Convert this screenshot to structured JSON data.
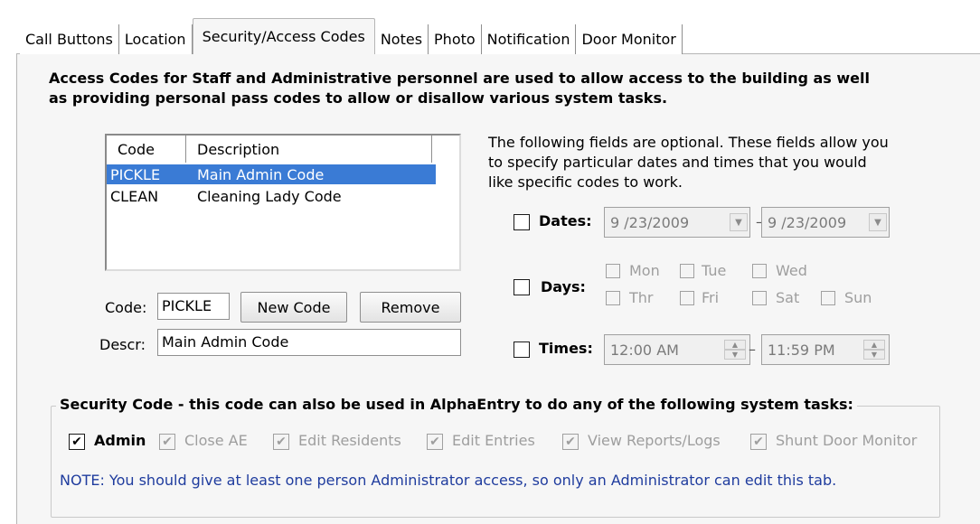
{
  "tabs": [
    "Call Buttons",
    "Location",
    "Security/Access Codes",
    "Notes",
    "Photo",
    "Notification",
    "Door Monitor"
  ],
  "active_tab_index": 2,
  "intro": {
    "line1": "Access Codes for Staff and Administrative personnel are used to allow access to the building as well",
    "line2": "as providing personal pass codes to allow or disallow various system tasks."
  },
  "codes_list": {
    "columns": [
      "Code",
      "Description"
    ],
    "rows": [
      {
        "code": "PICKLE",
        "description": "Main Admin Code",
        "selected": true
      },
      {
        "code": "CLEAN",
        "description": "Cleaning Lady Code",
        "selected": false
      }
    ]
  },
  "code_field": {
    "label": "Code:",
    "value": "PICKLE"
  },
  "descr_field": {
    "label": "Descr:",
    "value": "Main Admin Code"
  },
  "buttons": {
    "new_code": "New Code",
    "remove": "Remove"
  },
  "optional_text": {
    "line1": "The following fields are optional. These fields allow you",
    "line2": "to specify particular dates and times that you would",
    "line3": "like specific codes to work."
  },
  "dates": {
    "label": "Dates:",
    "from": "9 /23/2009",
    "separator": "–",
    "to": "9 /23/2009",
    "checked": false
  },
  "days": {
    "label": "Days:",
    "checked": false,
    "items": [
      "Mon",
      "Tue",
      "Wed",
      "Thr",
      "Fri",
      "Sat",
      "Sun"
    ]
  },
  "times": {
    "label": "Times:",
    "from": "12:00 AM",
    "separator": "–",
    "to": "11:59 PM",
    "checked": false
  },
  "security_group": {
    "legend": "Security Code - this code can also be used in AlphaEntry to do any of the following system tasks:",
    "items": [
      {
        "label": "Admin",
        "checked": true,
        "enabled": true
      },
      {
        "label": "Close AE",
        "checked": true,
        "enabled": false
      },
      {
        "label": "Edit Residents",
        "checked": true,
        "enabled": false
      },
      {
        "label": "Edit Entries",
        "checked": true,
        "enabled": false
      },
      {
        "label": "View Reports/Logs",
        "checked": true,
        "enabled": false
      },
      {
        "label": "Shunt Door Monitor",
        "checked": true,
        "enabled": false
      }
    ],
    "note": "NOTE: You should give at least one person Administrator access, so only an Administrator can edit this tab."
  },
  "colors": {
    "selection": "#3a7bd5",
    "note": "#1f3c9e",
    "panel": "#f6f6f6"
  },
  "icons": {
    "combo_arrow": "dropdown-arrow-icon",
    "spin": "spin-arrows-icon",
    "check": "checkmark-icon"
  }
}
